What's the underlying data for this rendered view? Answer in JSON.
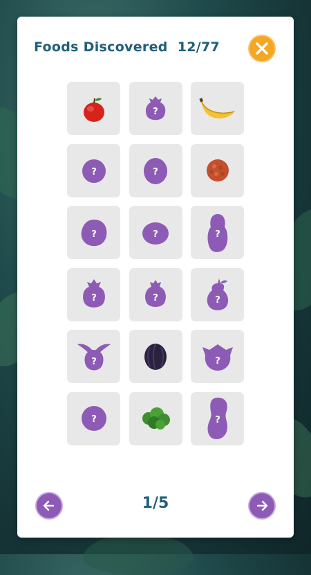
{
  "header": {
    "title": "Foods Discovered",
    "progress_text": "12/77"
  },
  "colors": {
    "title": "#1f5f7a",
    "close_button": "#f5a623",
    "nav_button": "#8d5bb5",
    "silhouette": "#8d5bb5",
    "tile": "#e8e8e8"
  },
  "foods": [
    {
      "icon": "apple-icon",
      "discovered": true
    },
    {
      "icon": "locked-fruit-icon",
      "discovered": false,
      "label": "?"
    },
    {
      "icon": "banana-icon",
      "discovered": true
    },
    {
      "icon": "locked-fruit-icon",
      "discovered": false,
      "label": "?"
    },
    {
      "icon": "locked-fruit-icon",
      "discovered": false,
      "label": "?"
    },
    {
      "icon": "lychee-icon",
      "discovered": true
    },
    {
      "icon": "locked-fruit-icon",
      "discovered": false,
      "label": "?"
    },
    {
      "icon": "locked-fruit-icon",
      "discovered": false,
      "label": "?"
    },
    {
      "icon": "locked-fruit-icon",
      "discovered": false,
      "label": "?"
    },
    {
      "icon": "locked-fruit-icon",
      "discovered": false,
      "label": "?"
    },
    {
      "icon": "locked-fruit-icon",
      "discovered": false,
      "label": "?"
    },
    {
      "icon": "locked-fruit-icon",
      "discovered": false,
      "label": "?"
    },
    {
      "icon": "locked-fruit-icon",
      "discovered": false,
      "label": "?"
    },
    {
      "icon": "blackberry-icon",
      "discovered": true
    },
    {
      "icon": "locked-fruit-icon",
      "discovered": false,
      "label": "?"
    },
    {
      "icon": "locked-fruit-icon",
      "discovered": false,
      "label": "?"
    },
    {
      "icon": "broccoli-icon",
      "discovered": true
    },
    {
      "icon": "locked-fruit-icon",
      "discovered": false,
      "label": "?"
    }
  ],
  "pagination": {
    "current": "1",
    "total": "5",
    "text": "1/5"
  }
}
